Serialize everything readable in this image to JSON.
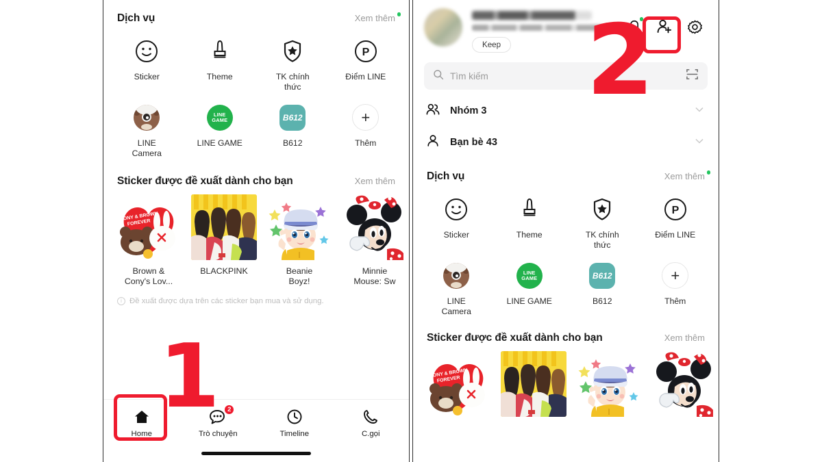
{
  "meta": {
    "accent_red": "#ef1b2e",
    "green_dot": "#22c55e",
    "line_green": "#22b24c",
    "b612_teal": "#5cb2ae"
  },
  "annotations": [
    {
      "label": "1",
      "target": "home-tab"
    },
    {
      "label": "2",
      "target": "add-friend-icon"
    }
  ],
  "services": {
    "title": "Dịch vụ",
    "more_label": "Xem thêm",
    "items": [
      {
        "label": "Sticker",
        "icon": "smiley-face-icon"
      },
      {
        "label": "Theme",
        "icon": "paint-brush-icon"
      },
      {
        "label": "TK chính\nthức",
        "icon": "shield-star-icon"
      },
      {
        "label": "Điểm LINE",
        "icon": "point-p-icon"
      },
      {
        "label": "LINE\nCamera",
        "icon": "line-camera-icon"
      },
      {
        "label": "LINE GAME",
        "icon": "line-game-icon"
      },
      {
        "label": "B612",
        "icon": "b612-icon"
      },
      {
        "label": "Thêm",
        "icon": "plus-icon"
      }
    ],
    "line_game_text": [
      "LINE",
      "GAME"
    ],
    "b612_text": "B612",
    "point_letter": "P",
    "plus_glyph": "+"
  },
  "stickers": {
    "title": "Sticker được đề xuất dành cho bạn",
    "more_label": "Xem thêm",
    "items": [
      {
        "name": "Brown &\nCony's Lov...",
        "art": "brown-cony-heart"
      },
      {
        "name": "BLACKPINK",
        "art": "blackpink-photo"
      },
      {
        "name": "Beanie\nBoyz!",
        "art": "beanie-boy"
      },
      {
        "name": "Minnie\nMouse: Sw",
        "art": "minnie-mouse"
      }
    ],
    "note": "Đề xuất được dựa trên các sticker bạn mua và sử dụng.",
    "note_icon": "info-icon",
    "heart_text": [
      "CONY & BROWN",
      "FOREVER"
    ]
  },
  "tabbar": {
    "items": [
      {
        "label": "Home",
        "icon": "home-icon",
        "badge": null,
        "active": true
      },
      {
        "label": "Trò chuyện",
        "icon": "chat-icon",
        "badge": "2",
        "active": false
      },
      {
        "label": "Timeline",
        "icon": "clock-icon",
        "badge": null,
        "active": false
      },
      {
        "label": "C.gọi",
        "icon": "phone-icon",
        "badge": null,
        "active": false
      }
    ]
  },
  "profile": {
    "name": "",
    "status": "",
    "keep_label": "Keep",
    "avatar_icon": "avatar",
    "actions": [
      {
        "icon": "bell-icon",
        "name": "notifications-button"
      },
      {
        "icon": "add-friend-icon",
        "name": "add-friend-button"
      },
      {
        "icon": "gear-icon",
        "name": "settings-button"
      }
    ]
  },
  "search": {
    "placeholder": "Tìm kiếm",
    "icon": "search-icon",
    "scan_icon": "qr-scan-icon"
  },
  "friend_lists": [
    {
      "label": "Nhóm 3",
      "icon": "group-icon",
      "chevron": "chevron-down-icon"
    },
    {
      "label": "Bạn bè 43",
      "icon": "person-icon",
      "chevron": "chevron-down-icon"
    }
  ]
}
